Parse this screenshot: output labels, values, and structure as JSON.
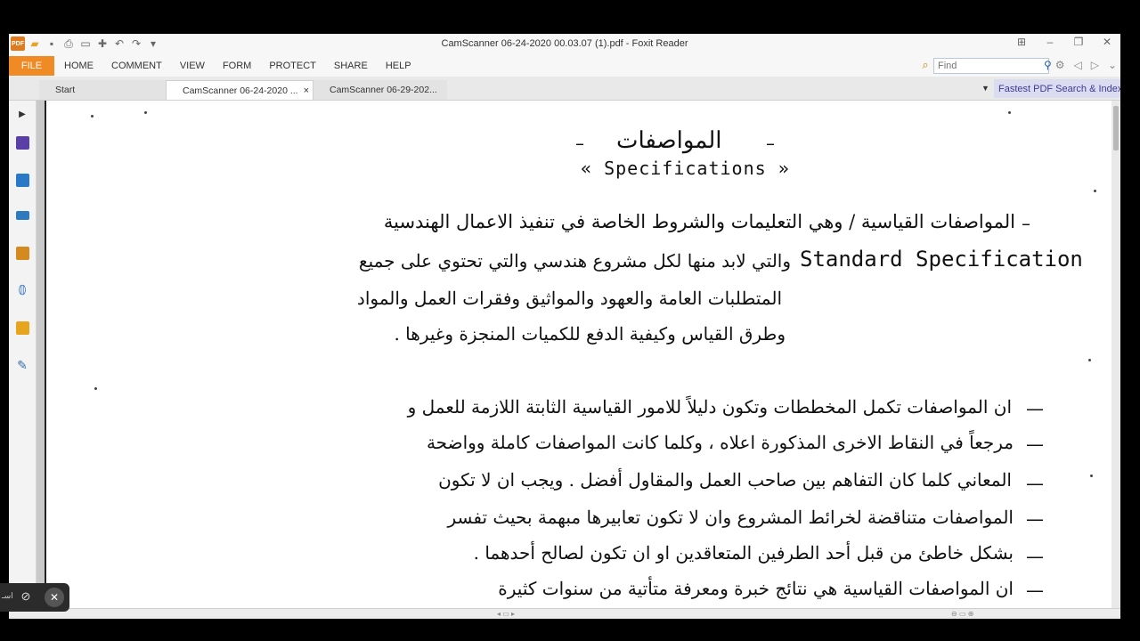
{
  "window": {
    "title": "CamScanner 06-24-2020 00.03.07 (1).pdf - Foxit Reader",
    "qat_icons": [
      "pdf-icon",
      "open-folder-icon",
      "save-icon",
      "print-icon",
      "properties-icon",
      "new-doc-icon",
      "undo-icon",
      "redo-icon",
      "customize-icon"
    ],
    "controls": [
      "ribbon-toggle-icon",
      "minimize-icon",
      "restore-icon",
      "close-icon"
    ]
  },
  "ribbon": {
    "file_label": "FILE",
    "tabs": [
      "HOME",
      "COMMENT",
      "VIEW",
      "FORM",
      "PROTECT",
      "SHARE",
      "HELP"
    ],
    "find_placeholder": "Find"
  },
  "tabs": {
    "items": [
      {
        "label": "Start"
      },
      {
        "label": "CamScanner 06-24-2020 ..."
      },
      {
        "label": "CamScanner 06-29-202..."
      }
    ],
    "close_glyph": "×",
    "promo": "Fastest PDF Search & Index"
  },
  "document": {
    "heading_ar": "المواصفات",
    "heading_en": "« Specifications »",
    "para1": [
      "المواصفات القياسية / وهي التعليمات والشروط الخاصة في تنفيذ الاعمال الهندسية",
      "والتي لابد منها لكل مشروع هندسي والتي تحتوي على جميع",
      "المتطلبات العامة والعهود والمواثيق وفقرات العمل والمواد",
      "وطرق القياس وكيفية الدفع للكميات المنجزة وغيرها ."
    ],
    "standard_spec": "Standard Specification",
    "para2": [
      "ان المواصفات تكمل المخططات وتكون دليلاً للامور القياسية الثابتة اللازمة للعمل و",
      "مرجعاً في النقاط الاخرى المذكورة اعلاه ، وكلما كانت المواصفات كاملة وواضحة",
      "المعاني كلما كان التفاهم بين صاحب العمل والمقاول أفضل . ويجب ان لا تكون",
      "المواصفات متناقضة لخرائط المشروع وان لا تكون تعابيرها مبهمة بحيث تفسر",
      "بشكل خاطئ من قبل أحد الطرفين المتعاقدين او ان تكون لصالح أحدهما .",
      "ان المواصفات القياسية هي نتائج خبرة ومعرفة متأتية من سنوات كثيرة"
    ]
  },
  "overlay": {
    "label": "اسـ"
  }
}
